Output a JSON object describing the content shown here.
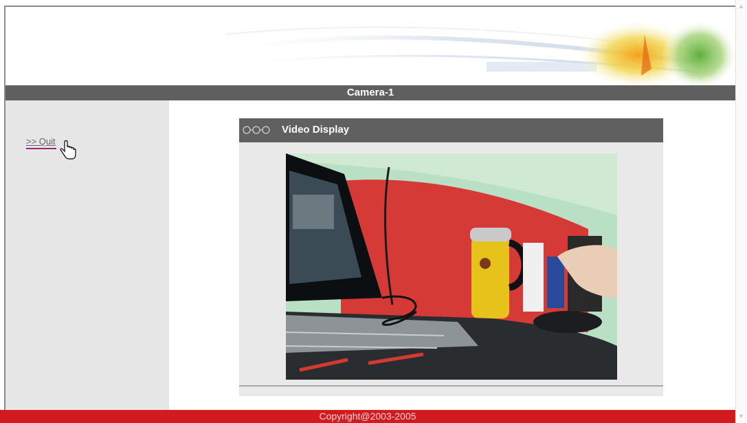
{
  "header": {
    "camera_title": "Camera-1"
  },
  "sidebar": {
    "quit_label": ">> Quit"
  },
  "panel": {
    "title": "Video Display"
  },
  "footer": {
    "copyright": "Copyright@2003-2005"
  },
  "icons": {
    "panel_header": "chain-links-icon",
    "cursor": "hand-pointer-icon",
    "scroll_up": "scroll-up-arrow-icon",
    "scroll_down": "scroll-down-arrow-icon"
  },
  "colors": {
    "title_bar": "#5f5f5f",
    "footer": "#d31a1f",
    "left_pane": "#e6e6e6",
    "link_underline": "#9b2b6e"
  }
}
